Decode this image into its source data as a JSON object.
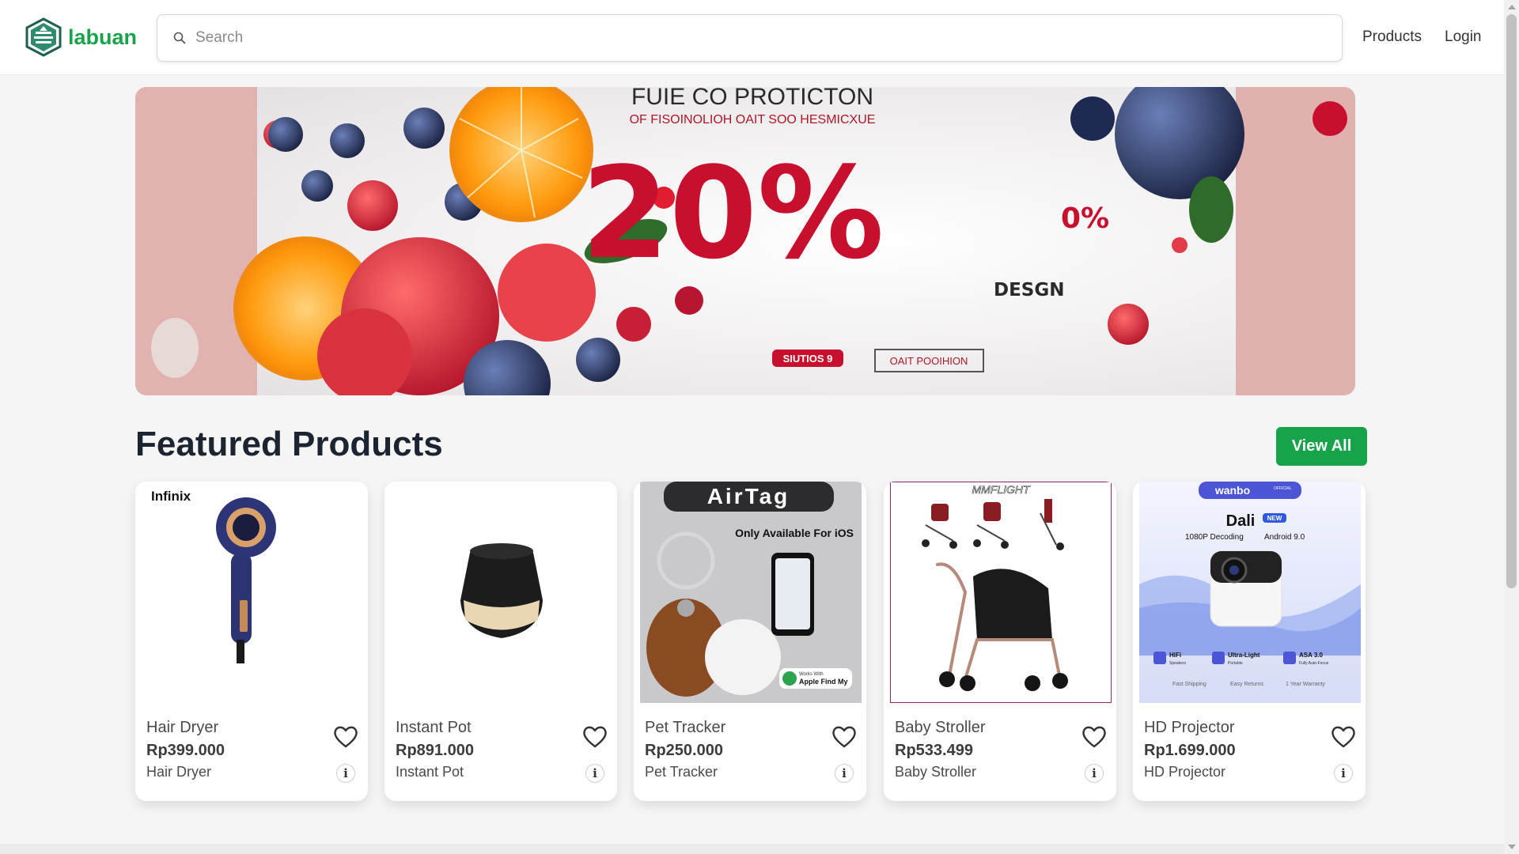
{
  "header": {
    "logo_text": "labuan",
    "search_placeholder": "Search",
    "nav": {
      "products": "Products",
      "login": "Login"
    }
  },
  "banner": {
    "headline": "FUIE CO PROTICTON",
    "subline": "OF FISOINOLIOH OAIT SOO HESMICXUE",
    "percent": "20%",
    "percent_small": "0%",
    "design": "DESGN",
    "button_left": "SIUTIOS 9",
    "button_right": "OAIT POOIHION"
  },
  "featured": {
    "title": "Featured Products",
    "view_all": "View All"
  },
  "products": [
    {
      "name": "Hair Dryer",
      "price": "Rp399.000",
      "subtitle": "Hair Dryer",
      "image_brand": "Infinix",
      "image_icon": "hair-dryer"
    },
    {
      "name": "Instant Pot",
      "price": "Rp891.000",
      "subtitle": "Instant Pot",
      "image_icon": "rice-cooker"
    },
    {
      "name": "Pet Tracker",
      "price": "Rp250.000",
      "subtitle": "Pet Tracker",
      "image_title": "AirTag",
      "image_tagline": "Only Available For iOS",
      "image_badge_small": "Works With",
      "image_badge": "Apple Find My",
      "image_icon": "airtag"
    },
    {
      "name": "Baby Stroller",
      "price": "Rp533.499",
      "subtitle": "Baby Stroller",
      "image_brand": "MMFLIGHT",
      "image_icon": "stroller"
    },
    {
      "name": "HD Projector",
      "price": "Rp1.699.000",
      "subtitle": "HD Projector",
      "image_brand": "wanbo",
      "image_brand_tag": "OFFICIAL",
      "image_model": "Dali",
      "image_model_tag": "NEW",
      "image_spec1": "1080P Decoding",
      "image_spec2": "Android 9.0",
      "image_features": [
        "HiFi",
        "Ultra-Light",
        "ASA 3.0"
      ],
      "image_features_sub": [
        "Speakers",
        "Portable",
        "Fully Auto-Focus"
      ],
      "image_footer": [
        "Fast Shipping",
        "Easy Returns",
        "1 Year Warranty"
      ],
      "image_icon": "projector"
    }
  ],
  "colors": {
    "brand": "#1aa34a",
    "button": "#16a34a",
    "banner_red": "#c8102e"
  }
}
